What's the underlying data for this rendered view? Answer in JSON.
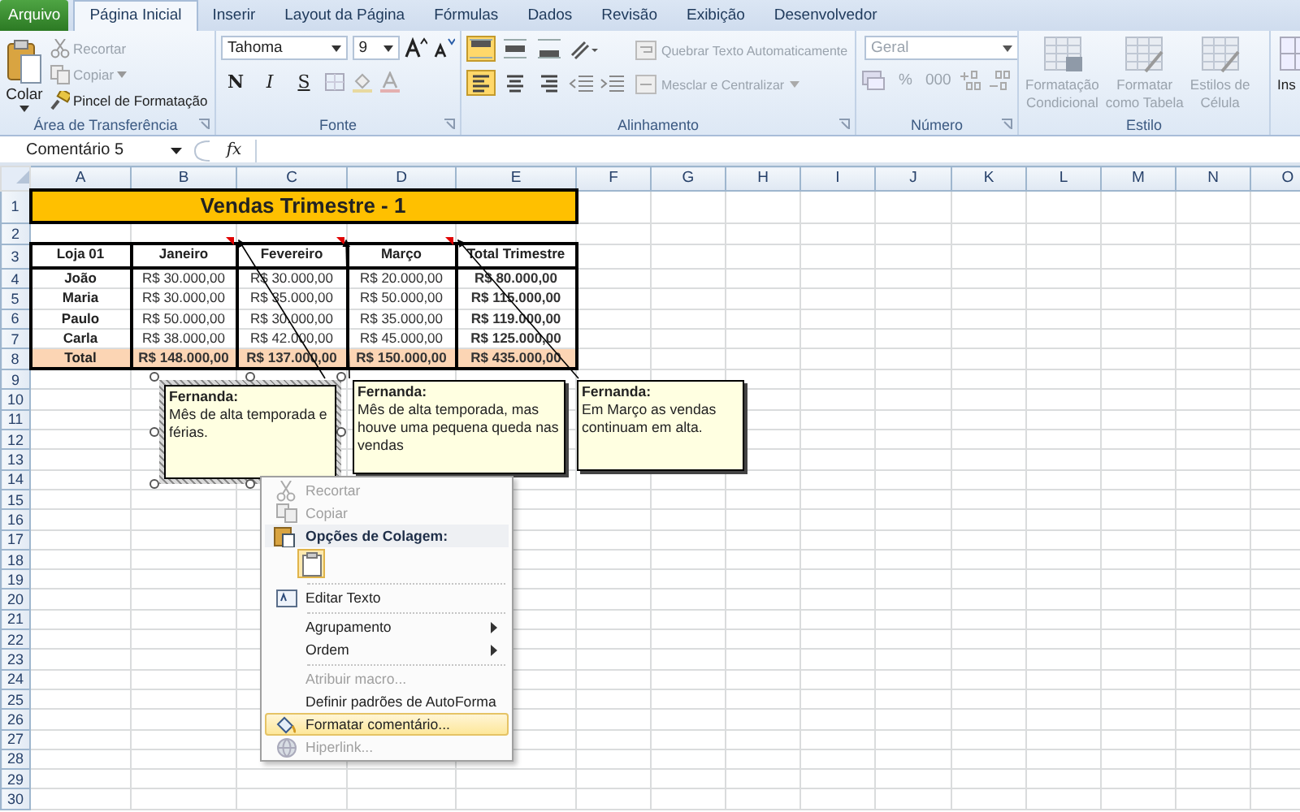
{
  "ribbon": {
    "tabs": [
      {
        "label": "Arquivo",
        "kind": "file",
        "selected": false
      },
      {
        "label": "Página Inicial",
        "kind": "tab",
        "selected": true
      },
      {
        "label": "Inserir",
        "kind": "tab",
        "selected": false
      },
      {
        "label": "Layout da Página",
        "kind": "tab",
        "selected": false
      },
      {
        "label": "Fórmulas",
        "kind": "tab",
        "selected": false
      },
      {
        "label": "Dados",
        "kind": "tab",
        "selected": false
      },
      {
        "label": "Revisão",
        "kind": "tab",
        "selected": false
      },
      {
        "label": "Exibição",
        "kind": "tab",
        "selected": false
      },
      {
        "label": "Desenvolvedor",
        "kind": "tab",
        "selected": false
      }
    ],
    "clipboard": {
      "label": "Área de Transferência",
      "paste": "Colar",
      "cut": {
        "label": "Recortar",
        "disabled": true
      },
      "copy": {
        "label": "Copiar",
        "disabled": true
      },
      "format_painter": {
        "label": "Pincel de Formatação",
        "disabled": false
      }
    },
    "font": {
      "label": "Fonte",
      "font_name": "Tahoma",
      "font_size": "9",
      "bold": "N",
      "italic": "I",
      "underline": "S"
    },
    "alignment": {
      "label": "Alinhamento",
      "vertical": [
        {
          "selected": true
        },
        {
          "selected": false
        },
        {
          "selected": false
        }
      ],
      "horizontal": [
        {
          "selected": true
        },
        {
          "selected": false
        },
        {
          "selected": false
        }
      ],
      "wrap_text": {
        "label": "Quebrar Texto Automaticamente",
        "disabled": true
      },
      "merge": {
        "label": "Mesclar e Centralizar",
        "disabled": true
      }
    },
    "number": {
      "label": "Número",
      "format": "Geral",
      "disabled": true,
      "percent": "%",
      "thousands": "000"
    },
    "styles": {
      "label": "Estilo",
      "buttons": [
        {
          "lines": [
            "Formatação",
            "Condicional"
          ],
          "disabled": true
        },
        {
          "lines": [
            "Formatar",
            "como Tabela"
          ],
          "disabled": true
        },
        {
          "lines": [
            "Estilos de",
            "Célula"
          ],
          "disabled": true
        }
      ]
    },
    "cells": {
      "label": "Ins"
    }
  },
  "formula_bar": {
    "name_box": "Comentário 5",
    "function_button": "fx"
  },
  "sheet": {
    "columns": [
      "A",
      "B",
      "C",
      "D",
      "E",
      "F",
      "G",
      "H",
      "I",
      "J",
      "K",
      "L",
      "M",
      "N",
      "O"
    ],
    "rows": [
      {
        "number": "1",
        "kind": "title",
        "cells": [
          "Vendas Trimestre - 1"
        ]
      },
      {
        "number": "2",
        "kind": "empty"
      },
      {
        "number": "3",
        "kind": "header",
        "cells": [
          "Loja 01",
          "Janeiro",
          "Fevereiro",
          "Março",
          "Total Trimestre"
        ]
      },
      {
        "number": "4",
        "kind": "data",
        "cells": [
          "João",
          "R$ 30.000,00",
          "R$ 30.000,00",
          "R$ 20.000,00",
          "R$ 80.000,00"
        ]
      },
      {
        "number": "5",
        "kind": "data",
        "cells": [
          "Maria",
          "R$ 30.000,00",
          "R$ 35.000,00",
          "R$ 50.000,00",
          "R$ 115.000,00"
        ]
      },
      {
        "number": "6",
        "kind": "data",
        "cells": [
          "Paulo",
          "R$ 50.000,00",
          "R$ 30.000,00",
          "R$ 35.000,00",
          "R$ 119.000,00"
        ]
      },
      {
        "number": "7",
        "kind": "data",
        "cells": [
          "Carla",
          "R$ 38.000,00",
          "R$ 42.000,00",
          "R$ 45.000,00",
          "R$ 125.000,00"
        ]
      },
      {
        "number": "8",
        "kind": "total",
        "cells": [
          "Total",
          "R$ 148.000,00",
          "R$ 137.000,00",
          "R$ 150.000,00",
          "R$ 435.000,00"
        ]
      },
      {
        "number": "9",
        "kind": "empty"
      },
      {
        "number": "10",
        "kind": "empty"
      },
      {
        "number": "11",
        "kind": "empty"
      },
      {
        "number": "12",
        "kind": "empty"
      },
      {
        "number": "13",
        "kind": "empty"
      },
      {
        "number": "14",
        "kind": "empty"
      },
      {
        "number": "15",
        "kind": "empty"
      },
      {
        "number": "16",
        "kind": "empty"
      },
      {
        "number": "17",
        "kind": "empty"
      },
      {
        "number": "18",
        "kind": "empty"
      },
      {
        "number": "19",
        "kind": "empty"
      },
      {
        "number": "20",
        "kind": "empty"
      },
      {
        "number": "21",
        "kind": "empty"
      },
      {
        "number": "22",
        "kind": "empty"
      },
      {
        "number": "23",
        "kind": "empty"
      },
      {
        "number": "24",
        "kind": "empty"
      },
      {
        "number": "25",
        "kind": "empty"
      },
      {
        "number": "26",
        "kind": "empty"
      },
      {
        "number": "27",
        "kind": "empty"
      },
      {
        "number": "28",
        "kind": "empty"
      },
      {
        "number": "29",
        "kind": "empty"
      },
      {
        "number": "30",
        "kind": "empty"
      }
    ]
  },
  "comments": [
    {
      "author": "Fernanda:",
      "text": "Mês de alta temporada e férias.",
      "selected": true
    },
    {
      "author": "Fernanda:",
      "text": "Mês de alta temporada, mas houve uma pequena queda nas vendas",
      "selected": false
    },
    {
      "author": "Fernanda:",
      "text": "Em Março as vendas continuam em alta.",
      "selected": false
    }
  ],
  "context_menu": [
    {
      "kind": "item",
      "label": "Recortar",
      "disabled": true,
      "highlighted": false,
      "submenu": false
    },
    {
      "kind": "item",
      "label": "Copiar",
      "disabled": true,
      "highlighted": false,
      "submenu": false
    },
    {
      "kind": "header",
      "label": "Opções de Colagem:"
    },
    {
      "kind": "paste"
    },
    {
      "kind": "separator"
    },
    {
      "kind": "item",
      "label": "Editar Texto",
      "disabled": false,
      "highlighted": false,
      "submenu": false
    },
    {
      "kind": "separator"
    },
    {
      "kind": "item",
      "label": "Agrupamento",
      "disabled": false,
      "highlighted": false,
      "submenu": true
    },
    {
      "kind": "item",
      "label": "Ordem",
      "disabled": false,
      "highlighted": false,
      "submenu": true
    },
    {
      "kind": "separator"
    },
    {
      "kind": "item",
      "label": "Atribuir macro...",
      "disabled": true,
      "highlighted": false,
      "submenu": false
    },
    {
      "kind": "item",
      "label": "Definir padrões de AutoForma",
      "disabled": false,
      "highlighted": false,
      "submenu": false
    },
    {
      "kind": "item",
      "label": "Formatar comentário...",
      "disabled": false,
      "highlighted": true,
      "submenu": false
    },
    {
      "kind": "item",
      "label": "Hiperlink...",
      "disabled": true,
      "highlighted": false,
      "submenu": false
    }
  ]
}
